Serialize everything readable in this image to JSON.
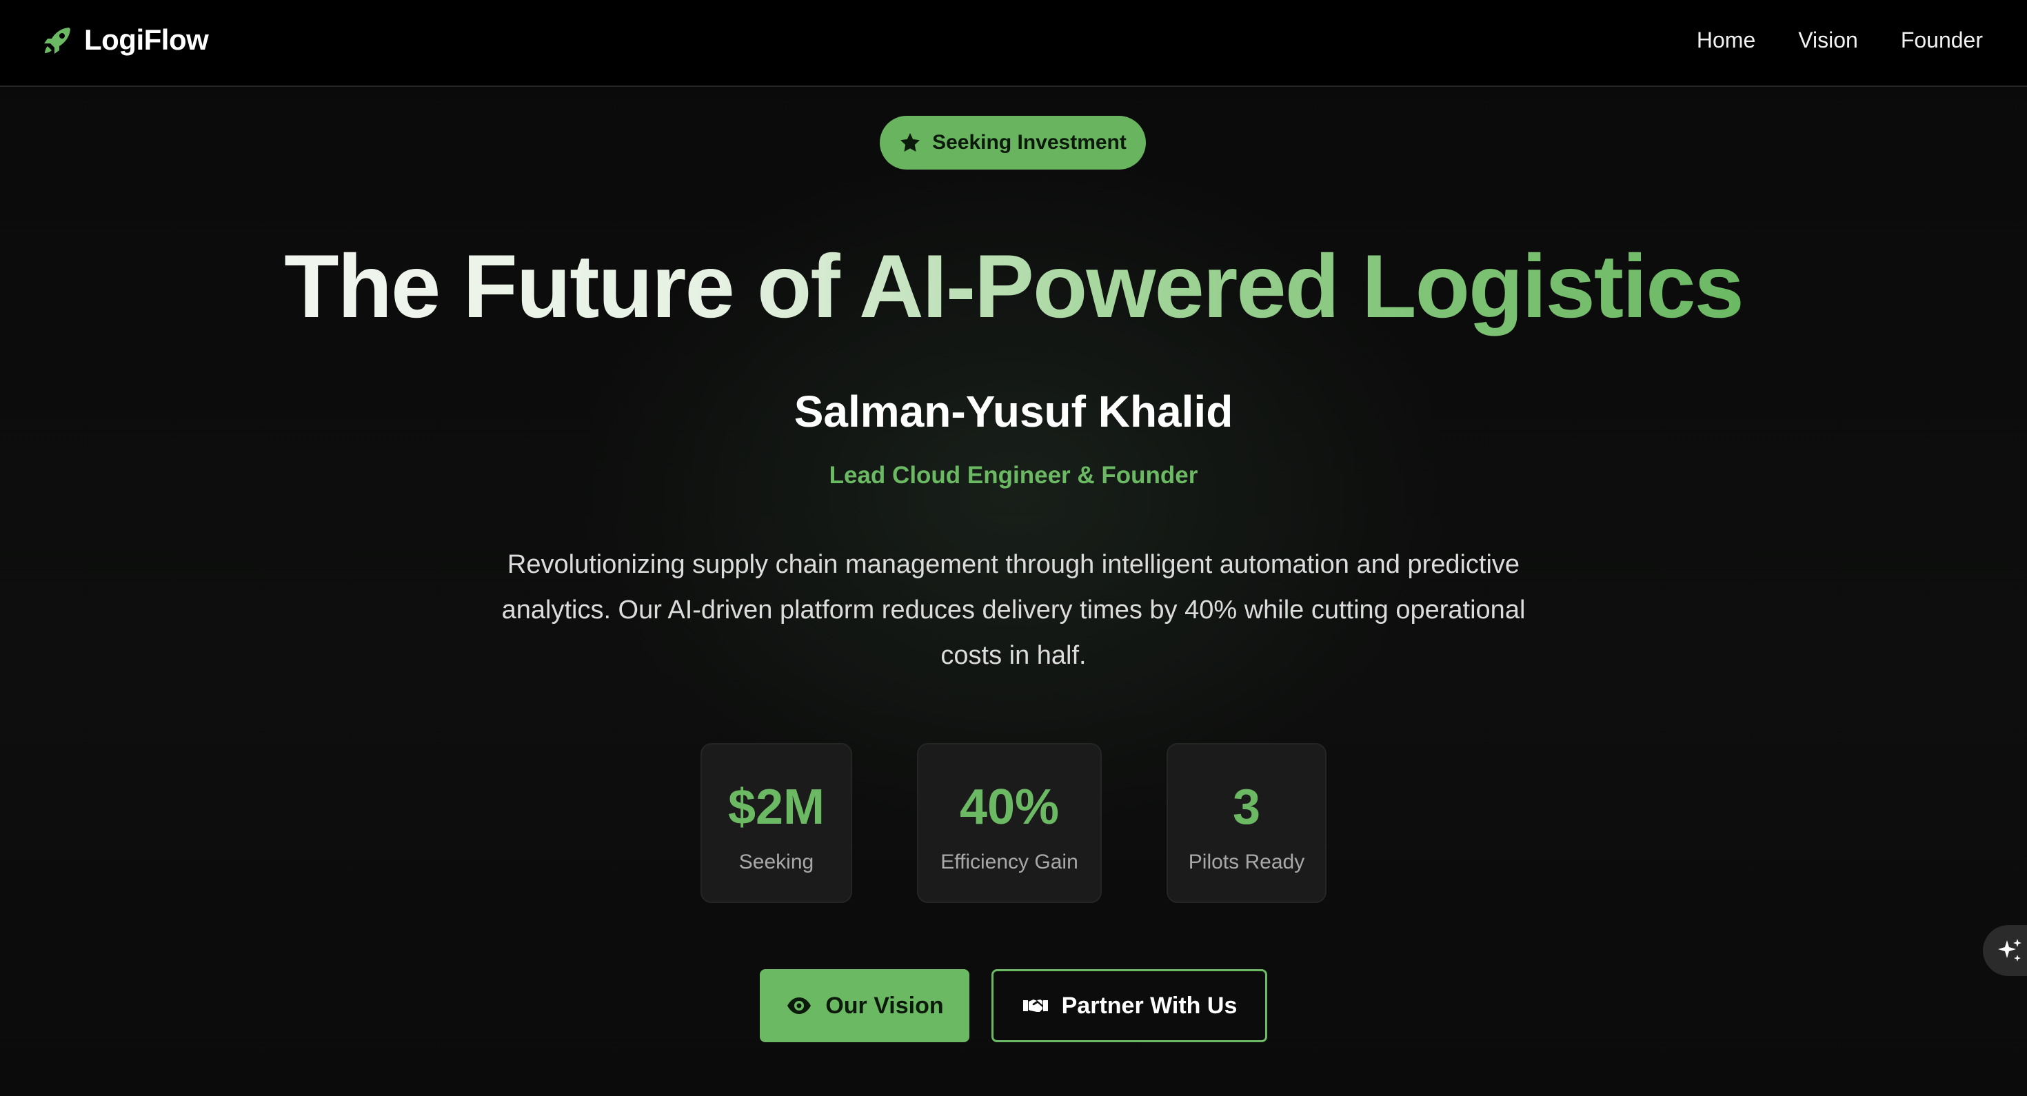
{
  "header": {
    "brand_name": "LogiFlow",
    "brand_icon": "rocket-icon",
    "nav": [
      {
        "label": "Home"
      },
      {
        "label": "Vision"
      },
      {
        "label": "Founder"
      }
    ]
  },
  "hero": {
    "badge": {
      "label": "Seeking Investment",
      "icon": "star-icon"
    },
    "title": "The Future of AI-Powered Logistics",
    "founder_name": "Salman-Yusuf Khalid",
    "founder_role": "Lead Cloud Engineer & Founder",
    "description": "Revolutionizing supply chain management through intelligent automation and predictive analytics. Our AI-driven platform reduces delivery times by 40% while cutting operational costs in half.",
    "stats": [
      {
        "value": "$2M",
        "label": "Seeking"
      },
      {
        "value": "40%",
        "label": "Efficiency Gain"
      },
      {
        "value": "3",
        "label": "Pilots Ready"
      }
    ],
    "buttons": {
      "primary": {
        "label": "Our Vision",
        "icon": "eye-icon"
      },
      "secondary": {
        "label": "Partner With Us",
        "icon": "handshake-icon"
      }
    }
  },
  "floating_button": {
    "icon": "sparkles-icon"
  },
  "colors": {
    "accent": "#6cb964",
    "background": "#0b0b0b",
    "header": "#000000",
    "card": "#1a1b1a"
  }
}
